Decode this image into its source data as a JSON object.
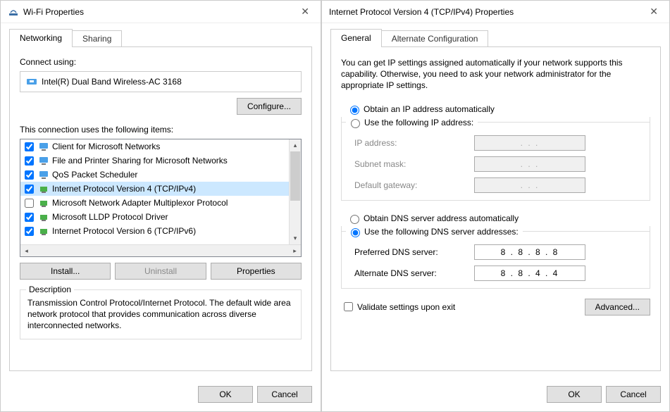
{
  "left": {
    "title": "Wi-Fi Properties",
    "tabs": {
      "active": "Networking",
      "inactive": "Sharing"
    },
    "connect_label": "Connect using:",
    "adapter": "Intel(R) Dual Band Wireless-AC 3168",
    "configure_btn": "Configure...",
    "items_label": "This connection uses the following items:",
    "items": [
      {
        "checked": true,
        "icon": "client",
        "label": "Client for Microsoft Networks"
      },
      {
        "checked": true,
        "icon": "client",
        "label": "File and Printer Sharing for Microsoft Networks"
      },
      {
        "checked": true,
        "icon": "client",
        "label": "QoS Packet Scheduler"
      },
      {
        "checked": true,
        "icon": "protocol",
        "label": "Internet Protocol Version 4 (TCP/IPv4)",
        "selected": true
      },
      {
        "checked": false,
        "icon": "protocol",
        "label": "Microsoft Network Adapter Multiplexor Protocol"
      },
      {
        "checked": true,
        "icon": "protocol",
        "label": "Microsoft LLDP Protocol Driver"
      },
      {
        "checked": true,
        "icon": "protocol",
        "label": "Internet Protocol Version 6 (TCP/IPv6)"
      }
    ],
    "install_btn": "Install...",
    "uninstall_btn": "Uninstall",
    "properties_btn": "Properties",
    "desc_title": "Description",
    "desc_text": "Transmission Control Protocol/Internet Protocol. The default wide area network protocol that provides communication across diverse interconnected networks.",
    "ok_btn": "OK",
    "cancel_btn": "Cancel"
  },
  "right": {
    "title": "Internet Protocol Version 4 (TCP/IPv4) Properties",
    "tabs": {
      "active": "General",
      "inactive": "Alternate Configuration"
    },
    "intro": "You can get IP settings assigned automatically if your network supports this capability. Otherwise, you need to ask your network administrator for the appropriate IP settings.",
    "ip_auto": "Obtain an IP address automatically",
    "ip_manual": "Use the following IP address:",
    "ip_fields": {
      "ip": "IP address:",
      "subnet": "Subnet mask:",
      "gateway": "Default gateway:"
    },
    "dns_auto": "Obtain DNS server address automatically",
    "dns_manual": "Use the following DNS server addresses:",
    "dns_fields": {
      "preferred_label": "Preferred DNS server:",
      "preferred_value": "8 . 8 . 8 . 8",
      "alternate_label": "Alternate DNS server:",
      "alternate_value": "8 . 8 . 4 . 4"
    },
    "validate": "Validate settings upon exit",
    "advanced_btn": "Advanced...",
    "ok_btn": "OK",
    "cancel_btn": "Cancel",
    "ip_placeholder": ".     .     ."
  }
}
